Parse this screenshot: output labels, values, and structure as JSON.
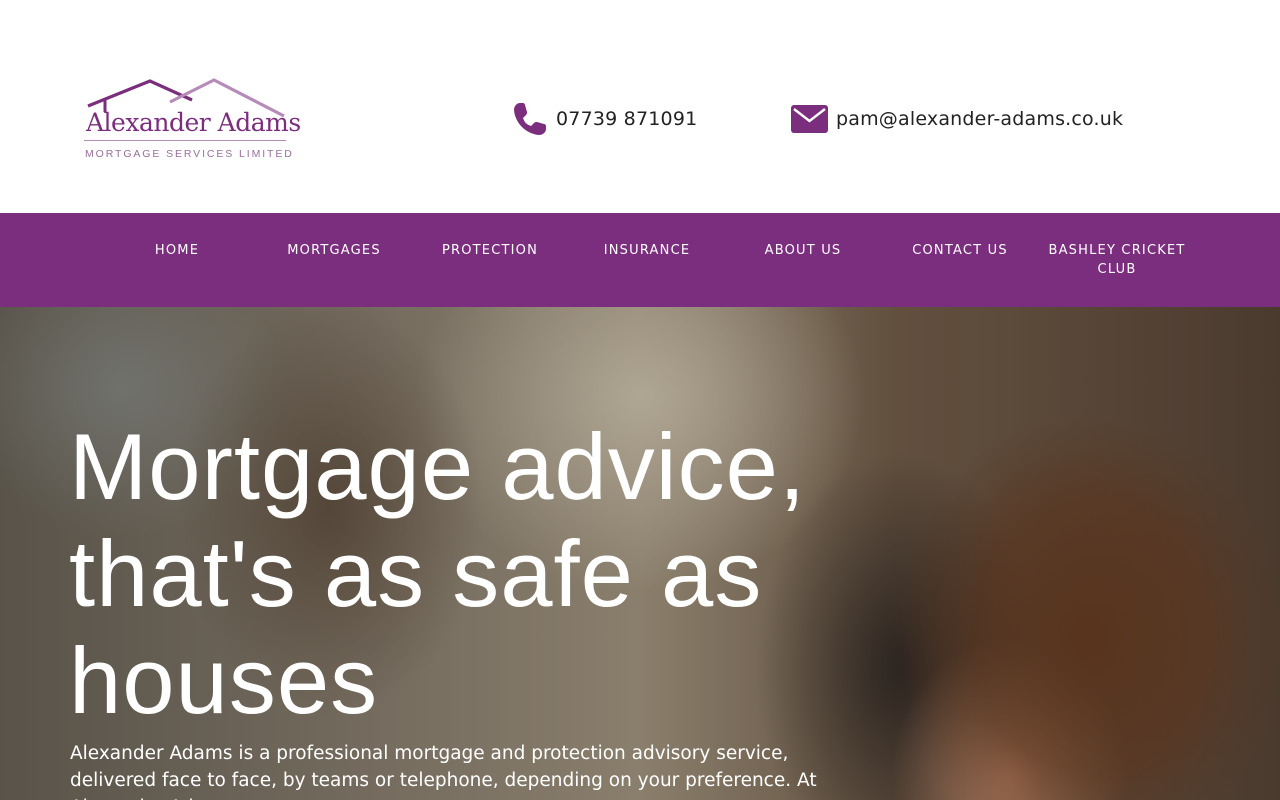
{
  "stray_text": ",",
  "brand": {
    "name": "Alexander Adams",
    "tagline": "MORTGAGE SERVICES LIMITED",
    "color_primary": "#7b2d7e",
    "color_secondary": "#b58bb7"
  },
  "contact": {
    "phone_icon": "phone-icon",
    "phone": "07739 871091",
    "email_icon": "envelope-icon",
    "email": "pam@alexander-adams.co.uk"
  },
  "nav": {
    "background": "#7b2d7e",
    "items": [
      {
        "label": "HOME"
      },
      {
        "label": "MORTGAGES"
      },
      {
        "label": "PROTECTION"
      },
      {
        "label": "INSURANCE"
      },
      {
        "label": "ABOUT US"
      },
      {
        "label": "CONTACT US"
      },
      {
        "label": "BASHLEY CRICKET CLUB"
      }
    ]
  },
  "hero": {
    "title": "Mortgage advice, that's as safe as houses",
    "body": "Alexander Adams is a professional mortgage and protection advisory service, delivered face to face, by teams or telephone, depending on your preference. At Alexander Adams we"
  }
}
